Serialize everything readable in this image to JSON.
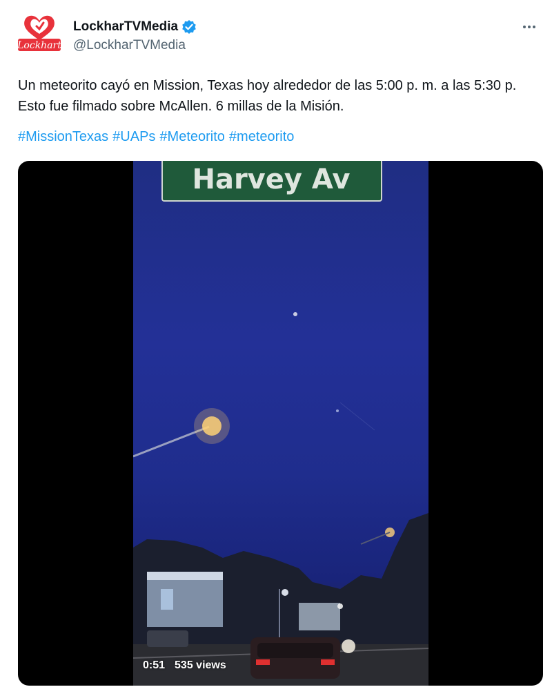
{
  "author": {
    "name": "LockharTVMedia",
    "handle": "@LockharTVMedia",
    "avatar_text": "Lockhart",
    "verified": true,
    "avatar_color": "#e8323b"
  },
  "tweet": {
    "text": "Un meteorito cayó en Mission, Texas hoy alrededor de las 5:00 p. m. a las 5:30 p. Esto fue filmado sobre McAllen. 6 millas de la Misión.",
    "hashtags": [
      "#MissionTexas",
      "#UAPs",
      "#Meteorito",
      "#meteorito"
    ]
  },
  "video": {
    "duration": "0:51",
    "views": "535 views",
    "sign_text": "Harvey  Av"
  },
  "icons": {
    "more": "more-options-icon",
    "verified": "verified-badge-icon"
  },
  "colors": {
    "link": "#1d9bf0",
    "verified": "#1d9bf0",
    "text": "#0f1419",
    "secondary": "#536471"
  }
}
